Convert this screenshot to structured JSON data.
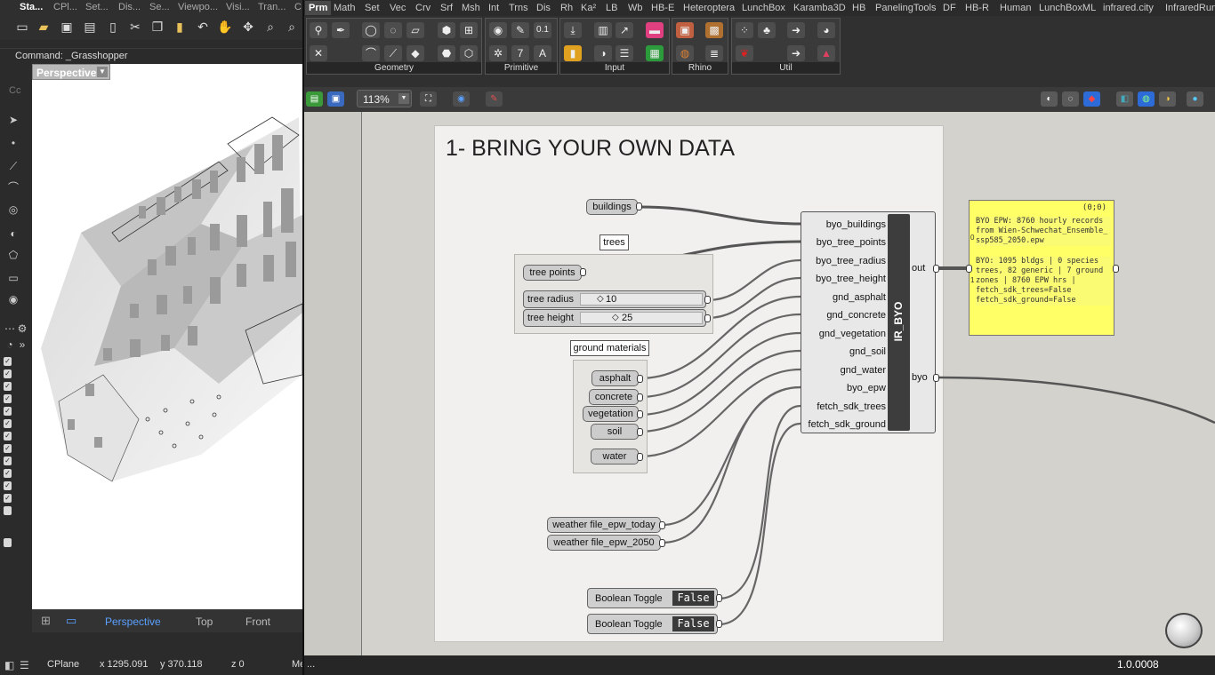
{
  "rhino": {
    "tabs": [
      "Sta...",
      "CPl...",
      "Set...",
      "Dis...",
      "Se...",
      "Viewpo...",
      "Visi...",
      "Tran...",
      "C"
    ],
    "command": "Command: _Grasshopper",
    "command_short": "Cc",
    "viewport_title": "Perspective",
    "viewport_tabs": [
      "Perspective",
      "Top",
      "Front"
    ],
    "status": {
      "cplane": "CPlane",
      "x": "x 1295.091",
      "y": "y 370.118",
      "z": "z 0",
      "me": "Me"
    }
  },
  "grasshopper": {
    "tabs": [
      "Prm",
      "Math",
      "Set",
      "Vec",
      "Crv",
      "Srf",
      "Msh",
      "Int",
      "Trns",
      "Dis",
      "Rh",
      "Ka²",
      "LB",
      "Wb",
      "HB-E",
      "Heteroptera",
      "LunchBox",
      "Karamba3D",
      "HB",
      "PanelingTools",
      "DF",
      "HB-R",
      "Human",
      "LunchBoxML",
      "infrared.city",
      "InfraredRun"
    ],
    "panels": [
      "Geometry",
      "Primitive",
      "Input",
      "Rhino",
      "Util"
    ],
    "zoom": "113%",
    "status_left": "...",
    "version": "1.0.0008"
  },
  "canvas": {
    "group_title": "1- BRING YOUR OWN DATA",
    "params": {
      "buildings": "buildings",
      "tree_points": "tree points",
      "asphalt": "asphalt",
      "concrete": "concrete",
      "vegetation": "vegetation",
      "soil": "soil",
      "water": "water",
      "epw_today": "weather file_epw_today",
      "epw_2050": "weather file_epw_2050"
    },
    "scribbles": {
      "trees": "trees",
      "ground": "ground materials"
    },
    "sliders": [
      {
        "label": "tree radius",
        "value": "10"
      },
      {
        "label": "tree height",
        "value": "25"
      }
    ],
    "toggles": [
      {
        "label": "Boolean Toggle",
        "value": "False"
      },
      {
        "label": "Boolean Toggle",
        "value": "False"
      }
    ],
    "component": {
      "name": "IR_BYO",
      "inputs": [
        "byo_buildings",
        "byo_tree_points",
        "byo_tree_radius",
        "byo_tree_height",
        "gnd_asphalt",
        "gnd_concrete",
        "gnd_vegetation",
        "gnd_soil",
        "gnd_water",
        "byo_epw",
        "fetch_sdk_trees",
        "fetch_sdk_ground"
      ],
      "outputs": [
        "out",
        "byo"
      ]
    },
    "panel": {
      "header": "(0;0)",
      "index0": "0",
      "index1": "1",
      "line0": "BYO EPW: 8760 hourly records from Wien-Schwechat_Ensemble_ssp585_2050.epw",
      "line1": "BYO: 1095 bldgs | 0 species trees, 82 generic | 7 ground zones | 8760 EPW hrs | fetch_sdk_trees=False fetch_sdk_ground=False"
    }
  }
}
